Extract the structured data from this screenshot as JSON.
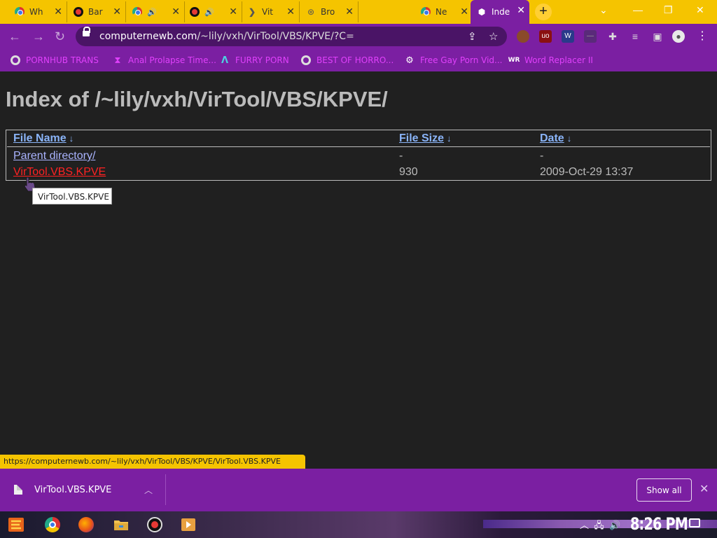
{
  "tabs": [
    {
      "title": "Wh",
      "favicon": "chrome-icon"
    },
    {
      "title": "Bar",
      "favicon": "record-icon"
    },
    {
      "title": "",
      "favicon": "chrome-icon",
      "audio": true
    },
    {
      "title": "",
      "favicon": "record-icon",
      "audio": true
    },
    {
      "title": "Vit",
      "favicon": "chevron-icon"
    },
    {
      "title": "Bro",
      "favicon": "ufo-icon"
    },
    {
      "title": "Ne",
      "favicon": "chrome-icon"
    },
    {
      "title": "Inde",
      "favicon": "cube-icon",
      "active": true
    }
  ],
  "address_bar": {
    "host": "computernewb.com",
    "path": "/~lily/vxh/VirTool/VBS/KPVE/?C="
  },
  "bookmarks": [
    {
      "label": "PORNHUB TRANS",
      "icon": "globe-icon"
    },
    {
      "label": "Anal Prolapse Time...",
      "icon": "hourglass-icon"
    },
    {
      "label": "FURRY PORN",
      "icon": "lambda-icon"
    },
    {
      "label": "BEST OF HORRO...",
      "icon": "globe-icon"
    },
    {
      "label": "Free Gay Porn Vid...",
      "icon": "gear-icon"
    },
    {
      "label": "Word Replacer II",
      "icon": "wr-icon"
    }
  ],
  "page": {
    "heading": "Index of /~lily/vxh/VirTool/VBS/KPVE/",
    "columns": {
      "name": "File Name",
      "size": "File Size",
      "date": "Date",
      "sort_arrow": "↓"
    },
    "rows": [
      {
        "name": "Parent directory/",
        "size": "-",
        "date": "-"
      },
      {
        "name": "VirTool.VBS.KPVE",
        "size": "930",
        "date": "2009-Oct-29 13:37",
        "hovered": true
      }
    ],
    "tooltip": "VirTool.VBS.KPVE"
  },
  "status_url": "https://computernewb.com/~lily/vxh/VirTool/VBS/KPVE/VirTool.VBS.KPVE",
  "download_shelf": {
    "filename": "VirTool.VBS.KPVE",
    "show_all": "Show all"
  },
  "taskbar": {
    "clock": "8:26 PM"
  },
  "colors": {
    "tab_strip": "#f5c400",
    "toolbar": "#7b1fa2",
    "page_bg": "#202020",
    "link": "#aab4ff",
    "hover_link": "#ff2222"
  }
}
